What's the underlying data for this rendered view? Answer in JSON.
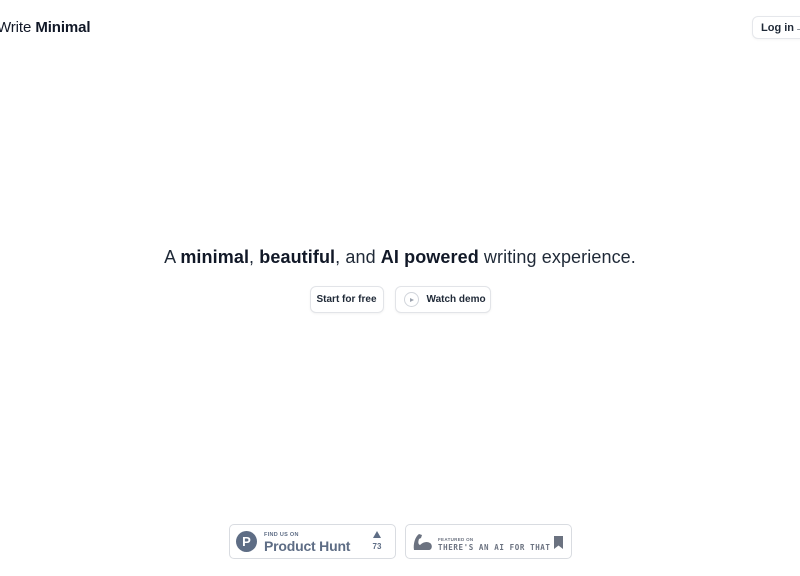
{
  "header": {
    "logo_light": "Write",
    "logo_bold": "Minimal",
    "login_label": "Log in",
    "login_arrow": "→"
  },
  "hero": {
    "part1": "A ",
    "bold1": "minimal",
    "part2": ", ",
    "bold2": "beautiful",
    "part3": ", and ",
    "bold3": "AI powered",
    "part4": " writing experience."
  },
  "cta": {
    "start_label": "Start for free",
    "demo_label": "Watch demo",
    "demo_icon": "play-icon"
  },
  "badges": {
    "product_hunt": {
      "logo_letter": "P",
      "small": "FIND US ON",
      "big": "Product Hunt",
      "upvotes": "73",
      "color": "#5e6d85"
    },
    "ai_for_that": {
      "small": "FEATURED ON",
      "big": "THERE'S AN AI FOR THAT",
      "icon": "bookmark-icon",
      "color": "#6b7280"
    }
  }
}
